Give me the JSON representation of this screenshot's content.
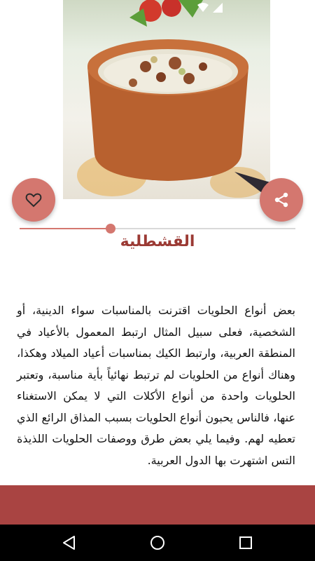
{
  "article": {
    "title": "القشطلية",
    "body": "بعض أنواع الحلويات اقترنت بالمناسبات سواء الدينية، أو الشخصية، فعلى سبيل المثال ارتبط المعمول بالأعياد في المنطقة العربية، وارتبط الكيك بمناسبات أعياد الميلاد وهكذا، وهناك أنواع من الحلويات لم ترتبط نهائياً بأية مناسبة، وتعتبر الحلويات واحدة من أنواع الأكلات التي لا يمكن الاستغناء عنها، فالناس يحبون أنواع الحلويات بسبب المذاق الرائع الذي تعطيه لهم. وفيما يلي بعض طرق ووصفات الحلويات اللذيذة التس اشتهرت بها الدول العربية."
  },
  "reading_progress": 0.33,
  "icons": {
    "like": "heart-outline-icon",
    "share": "share-icon",
    "nav_back": "triangle-back-icon",
    "nav_home": "circle-home-icon",
    "nav_recent": "square-recent-icon"
  },
  "colors": {
    "accent": "#d4776f",
    "title": "#9b3a34",
    "bottom_bar": "#a94442"
  }
}
